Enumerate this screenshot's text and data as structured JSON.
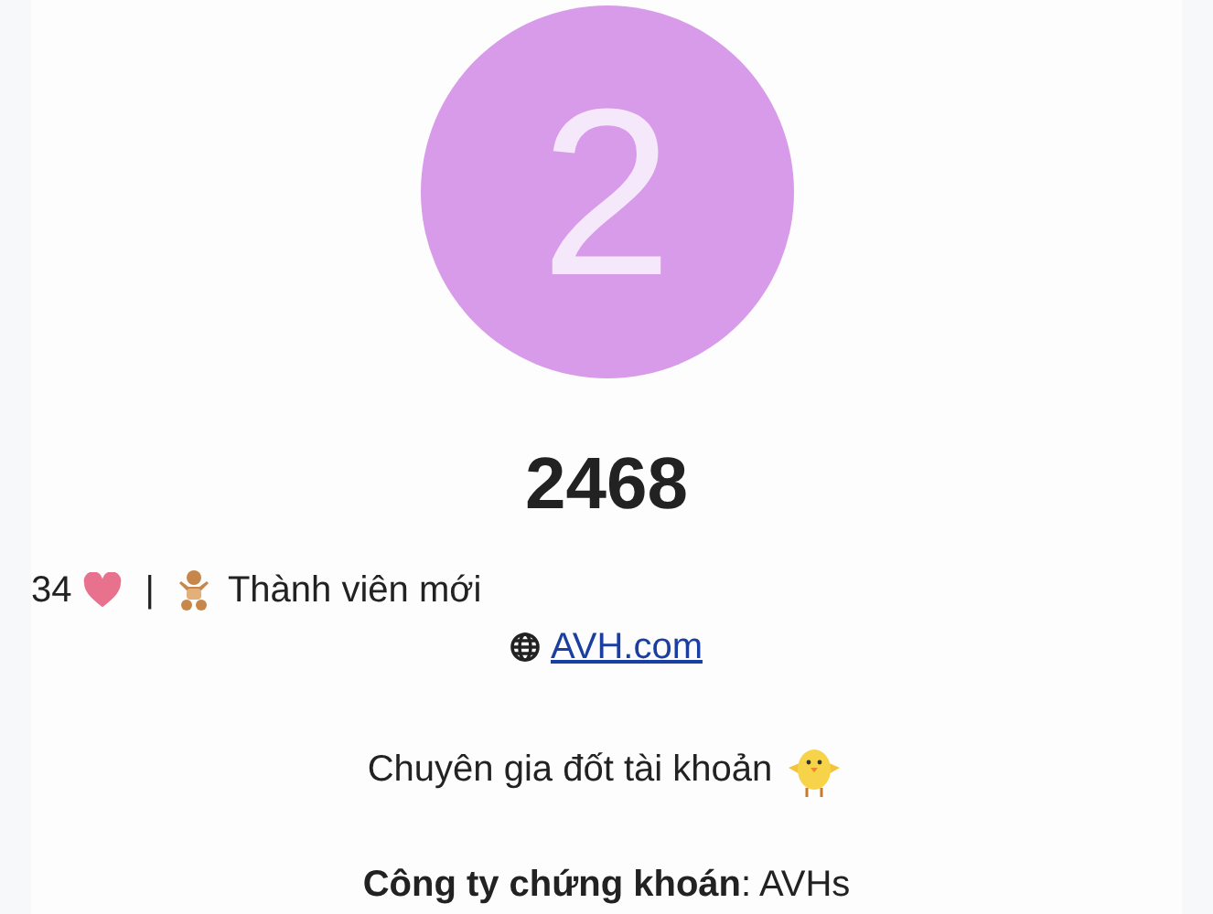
{
  "avatar": {
    "letter": "2"
  },
  "username": "2468",
  "stats": {
    "likes": "34",
    "separator": "|",
    "trust_level": "Thành viên mới"
  },
  "website": "AVH.com",
  "bio": "Chuyên gia đốt tài khoản",
  "fields": [
    {
      "text": "**Công ty chứng khoán**: AVHs"
    }
  ]
}
